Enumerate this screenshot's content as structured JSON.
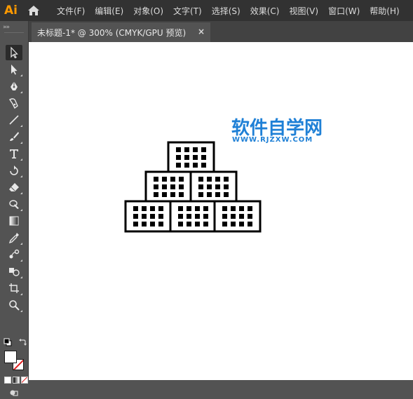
{
  "app": {
    "logo": "Ai"
  },
  "menu": [
    "文件(F)",
    "编辑(E)",
    "对象(O)",
    "文字(T)",
    "选择(S)",
    "效果(C)",
    "视图(V)",
    "窗口(W)",
    "帮助(H)"
  ],
  "tab": {
    "title": "未标题-1* @ 300% (CMYK/GPU 预览)",
    "close": "×"
  },
  "toolbar": {
    "grip": "»»",
    "tools": [
      "selection-tool-icon",
      "direct-selection-tool-icon",
      "pen-tool-icon",
      "curvature-tool-icon",
      "line-segment-tool-icon",
      "paintbrush-tool-icon",
      "type-tool-icon",
      "rotate-tool-icon",
      "eraser-tool-icon",
      "puppet-warp-tool-icon",
      "gradient-tool-icon",
      "eyedropper-tool-icon",
      "blend-tool-icon",
      "shape-builder-tool-icon",
      "artboard-tool-icon",
      "zoom-tool-icon"
    ],
    "fill_color": "#ffffff",
    "stroke_color": "none"
  },
  "watermark": {
    "title": "软件自学网",
    "url": "WWW.RJZXW.COM",
    "color": "#1f80d6"
  },
  "colors": {
    "menubar": "#323232",
    "panel": "#535353",
    "tabbar": "#424242",
    "canvas": "#ffffff"
  }
}
